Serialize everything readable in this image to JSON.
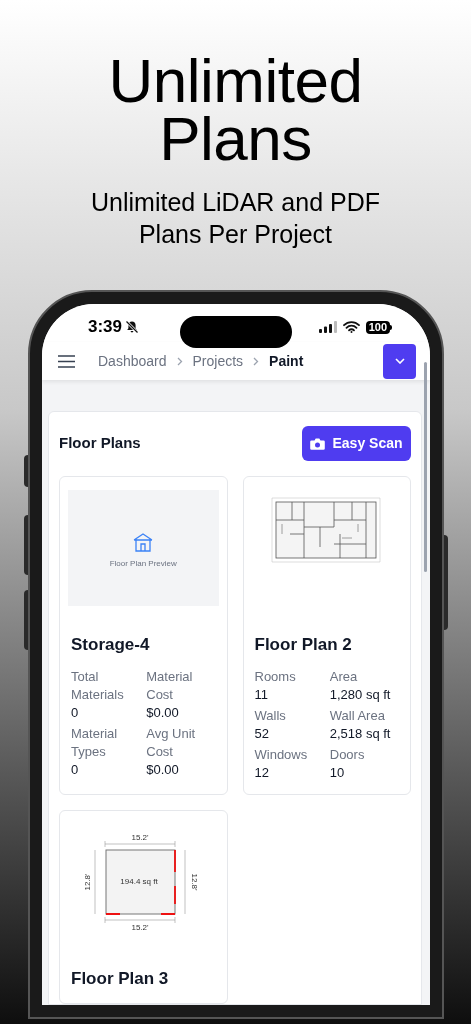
{
  "headline": "Unlimited Plans",
  "subheadline": "Unlimited LiDAR and PDF Plans Per Project",
  "status_bar": {
    "time": "3:39",
    "battery": "100"
  },
  "breadcrumbs": [
    {
      "label": "Dashboard",
      "selected": false
    },
    {
      "label": "Projects",
      "selected": false
    },
    {
      "label": "Paint",
      "selected": true
    }
  ],
  "section": {
    "title": "Floor Plans",
    "action": "Easy Scan"
  },
  "plans": [
    {
      "kind": "preview",
      "preview_label": "Floor Plan Preview",
      "title": "Storage-4",
      "stats": [
        {
          "label": "Total Materials",
          "value": "0"
        },
        {
          "label": "Material Cost",
          "value": "$0.00"
        },
        {
          "label": "Material Types",
          "value": "0"
        },
        {
          "label": "Avg Unit Cost",
          "value": "$0.00"
        }
      ]
    },
    {
      "kind": "layout",
      "title": "Floor Plan 2",
      "stats": [
        {
          "label": "Rooms",
          "value": "11"
        },
        {
          "label": "Area",
          "value": "1,280 sq ft"
        },
        {
          "label": "Walls",
          "value": "52"
        },
        {
          "label": "Wall Area",
          "value": "2,518 sq ft"
        },
        {
          "label": "Windows",
          "value": "12"
        },
        {
          "label": "Doors",
          "value": "10"
        }
      ]
    },
    {
      "kind": "room",
      "dimensions": {
        "top": "15.2'",
        "bottom": "15.2'",
        "left": "12.8'",
        "right": "12.8'",
        "area": "194.4 sq ft"
      },
      "title": "Floor Plan 3"
    }
  ]
}
